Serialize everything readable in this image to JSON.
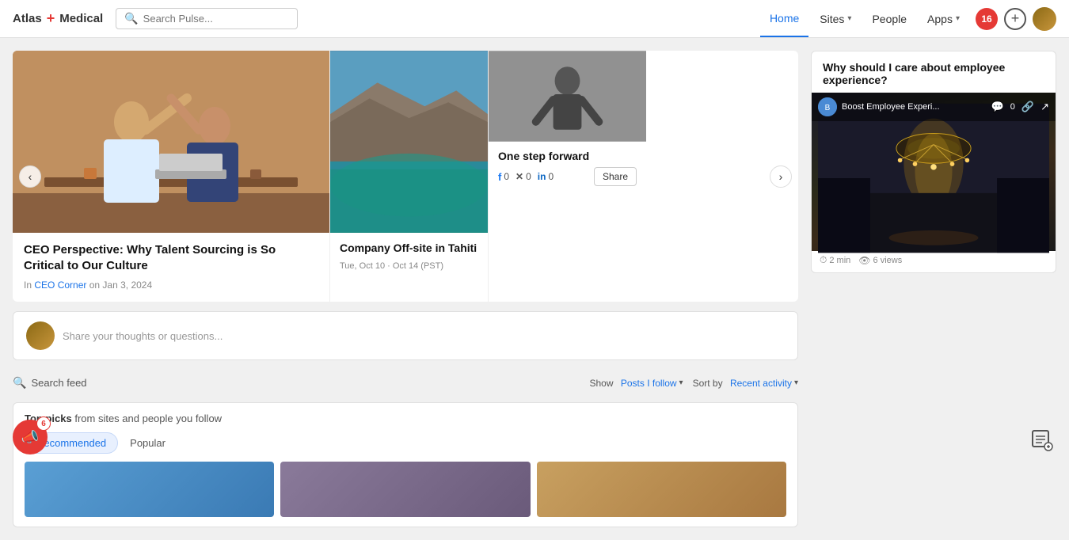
{
  "header": {
    "logo_name": "Atlas",
    "logo_plus": "+",
    "logo_brand": "Medical",
    "search_placeholder": "Search Pulse...",
    "nav": {
      "home": "Home",
      "sites": "Sites",
      "people": "People",
      "apps": "Apps"
    },
    "notification_count": "16"
  },
  "featured": {
    "prev_btn": "‹",
    "next_btn": "›",
    "card1": {
      "title": "CEO Perspective: Why Talent Sourcing is So Critical to Our Culture",
      "meta_prefix": "In",
      "meta_link": "CEO Corner",
      "meta_date": "on Jan 3, 2024"
    },
    "card2": {
      "title": "Company Off-site in Tahiti",
      "meta_date": "Tue, Oct 10 · Oct 14 (PST)"
    },
    "card3": {
      "title": "One step forward",
      "social": {
        "facebook": "0",
        "twitter": "0",
        "linkedin": "0"
      },
      "share_btn": "Share"
    }
  },
  "thought_box": {
    "placeholder": "Share your thoughts or questions..."
  },
  "search_feed": {
    "label": "Search feed",
    "show_label": "Show",
    "show_value": "Posts I follow",
    "sort_label": "Sort by",
    "sort_value": "Recent activity"
  },
  "top_picks": {
    "header_bold": "Top picks",
    "header_rest": " from sites and people you follow",
    "tabs": [
      {
        "label": "Recommended",
        "active": true
      },
      {
        "label": "Popular",
        "active": false
      }
    ]
  },
  "sidebar": {
    "card_title": "Why should I care about employee experience?",
    "video": {
      "channel": "Boost Employee Experi...",
      "comment_count": "0",
      "time_read": "2 min",
      "views": "6 views"
    }
  },
  "bottom": {
    "notif_count": "6"
  }
}
